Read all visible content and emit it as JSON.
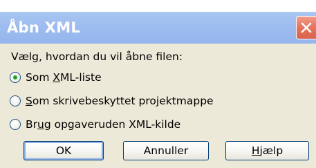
{
  "dialog": {
    "title": "Åbn XML",
    "close_icon": "close-x-icon",
    "prompt": "Vælg, hvordan du vil åbne filen:"
  },
  "options": [
    {
      "pre": "Som ",
      "accel": "X",
      "post": "ML-liste",
      "selected": true
    },
    {
      "pre": "",
      "accel": "S",
      "post": "om skrivebeskyttet projektmappe",
      "selected": false
    },
    {
      "pre": "Br",
      "accel": "u",
      "post": "g opgaveruden XML-kilde",
      "selected": false
    }
  ],
  "buttons": {
    "ok": "OK",
    "cancel": "Annuller",
    "help_accel": "H",
    "help_rest": "jælp"
  },
  "colors": {
    "titlebar": "#9fbdf0",
    "close": "#e6775f",
    "body": "#ece9d8",
    "radio_dot": "#21a121",
    "button_border": "#003c74"
  }
}
